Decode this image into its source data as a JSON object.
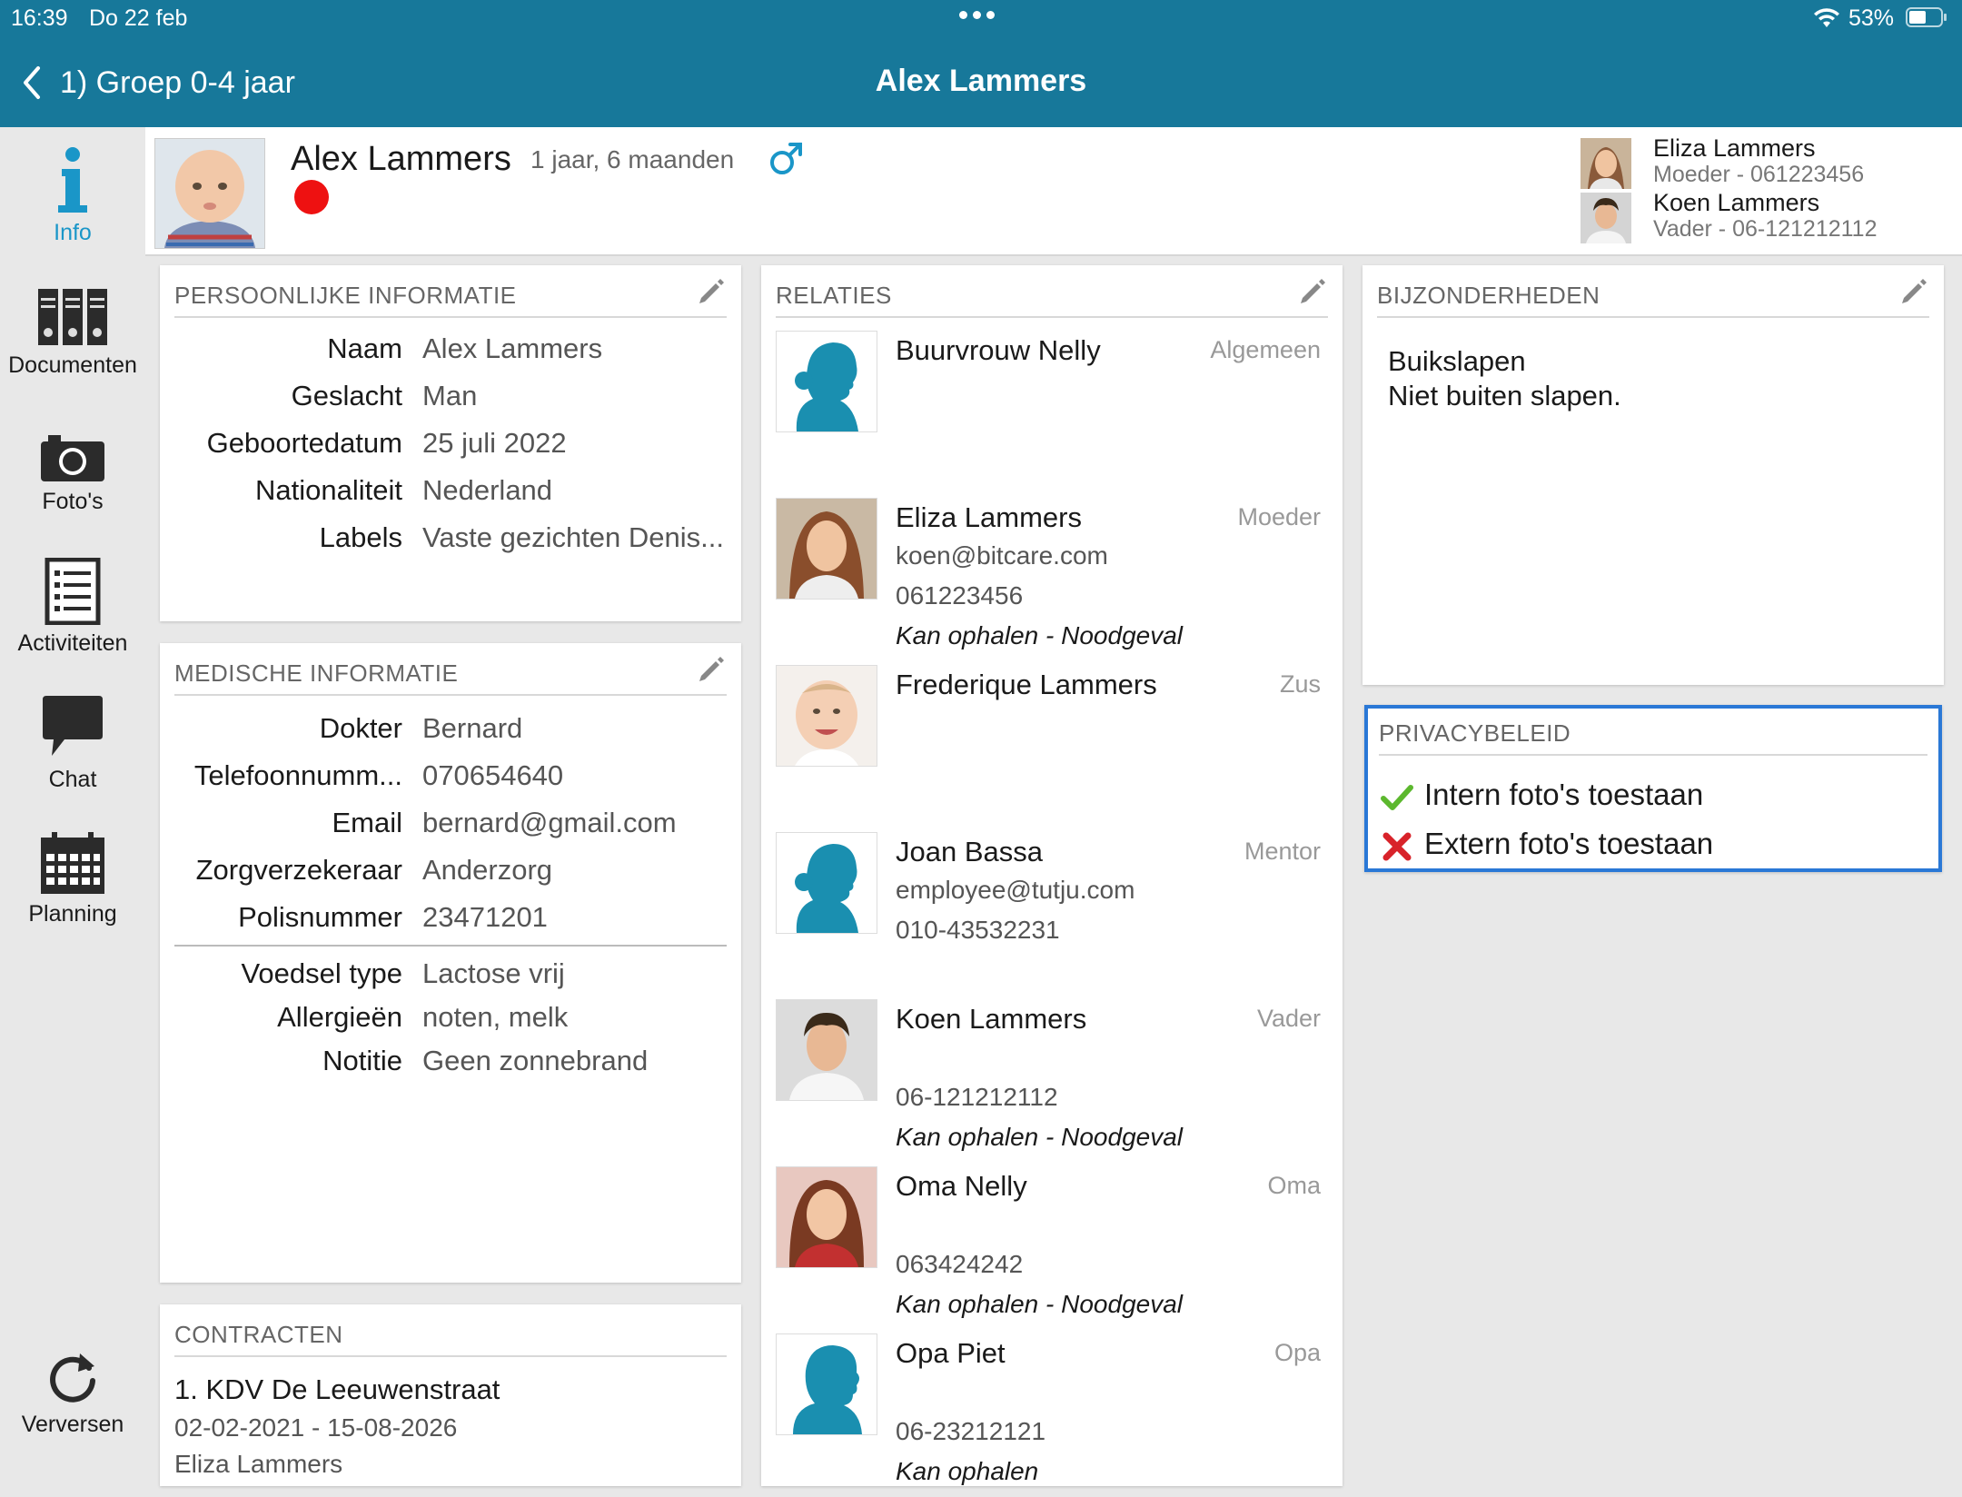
{
  "status_bar": {
    "time": "16:39",
    "date": "Do 22 feb",
    "battery": "53%"
  },
  "nav": {
    "back_label": "1) Groep 0-4 jaar",
    "title": "Alex Lammers"
  },
  "sidebar": {
    "items": [
      {
        "label": "Info",
        "icon": "info-icon"
      },
      {
        "label": "Documenten",
        "icon": "binders-icon"
      },
      {
        "label": "Foto's",
        "icon": "camera-icon"
      },
      {
        "label": "Activiteiten",
        "icon": "checklist-icon"
      },
      {
        "label": "Chat",
        "icon": "speech-bubble-icon"
      },
      {
        "label": "Planning",
        "icon": "calendar-icon"
      }
    ],
    "refresh_label": "Verversen"
  },
  "child": {
    "name": "Alex Lammers",
    "age": "1 jaar, 6 maanden",
    "gender_icon": "male-symbol-icon",
    "status_color": "#ee1111"
  },
  "parents": [
    {
      "name": "Eliza Lammers",
      "role": "Moeder - 061223456"
    },
    {
      "name": "Koen Lammers",
      "role": "Vader - 06-121212112"
    }
  ],
  "personal": {
    "title": "PERSOONLIJKE INFORMATIE",
    "rows": [
      {
        "key": "Naam",
        "value": "Alex Lammers"
      },
      {
        "key": "Geslacht",
        "value": "Man"
      },
      {
        "key": "Geboortedatum",
        "value": "25 juli 2022"
      },
      {
        "key": "Nationaliteit",
        "value": "Nederland"
      },
      {
        "key": "Labels",
        "value": "Vaste gezichten Denis..."
      }
    ]
  },
  "medical": {
    "title": "MEDISCHE INFORMATIE",
    "rows": [
      {
        "key": "Dokter",
        "value": "Bernard"
      },
      {
        "key": "Telefoonnumm...",
        "value": "070654640"
      },
      {
        "key": "Email",
        "value": "bernard@gmail.com"
      },
      {
        "key": "Zorgverzekeraar",
        "value": "Anderzorg"
      },
      {
        "key": "Polisnummer",
        "value": "23471201"
      }
    ],
    "rows2": [
      {
        "key": "Voedsel type",
        "value": "Lactose vrij"
      },
      {
        "key": "Allergieën",
        "value": "noten, melk"
      },
      {
        "key": "Notitie",
        "value": "Geen zonnebrand"
      }
    ]
  },
  "contracts": {
    "title": "CONTRACTEN",
    "item_name": "1. KDV De Leeuwenstraat",
    "item_dates": "02-02-2021 - 15-08-2026",
    "item_person": "Eliza Lammers"
  },
  "relations": {
    "title": "RELATIES",
    "items": [
      {
        "name": "Buurvrouw Nelly",
        "role": "Algemeen",
        "line1": "",
        "line2": "",
        "line3": "",
        "photo": "female-silhouette-icon"
      },
      {
        "name": "Eliza Lammers",
        "role": "Moeder",
        "line1": "koen@bitcare.com",
        "line2": "061223456",
        "line3": "Kan ophalen - Noodgeval",
        "photo": "woman-photo"
      },
      {
        "name": "Frederique Lammers",
        "role": "Zus",
        "line1": "",
        "line2": "",
        "line3": "",
        "photo": "baby-photo"
      },
      {
        "name": "Joan Bassa",
        "role": "Mentor",
        "line1": "employee@tutju.com",
        "line2": "010-43532231",
        "line3": "",
        "photo": "female-silhouette-icon"
      },
      {
        "name": "Koen Lammers",
        "role": "Vader",
        "line1": "",
        "line2": "06-121212112",
        "line3": "Kan ophalen - Noodgeval",
        "photo": "man-photo"
      },
      {
        "name": "Oma Nelly",
        "role": "Oma",
        "line1": "",
        "line2": "063424242",
        "line3": "Kan ophalen - Noodgeval",
        "photo": "woman-photo"
      },
      {
        "name": "Opa Piet",
        "role": "Opa",
        "line1": "",
        "line2": "06-23212121",
        "line3": "Kan ophalen",
        "photo": "male-silhouette-icon"
      }
    ]
  },
  "details": {
    "title": "BIJZONDERHEDEN",
    "line1": "Buikslapen",
    "line2": "Niet buiten slapen."
  },
  "privacy": {
    "title": "PRIVACYBELEID",
    "items": [
      {
        "label": "Intern foto's toestaan",
        "allowed": true
      },
      {
        "label": "Extern foto's toestaan",
        "allowed": false
      }
    ],
    "accent": "#2a78d6"
  },
  "colors": {
    "nav_bar": "#17789a",
    "accent": "#1a96c8",
    "silhouette": "#1a8fb0"
  }
}
